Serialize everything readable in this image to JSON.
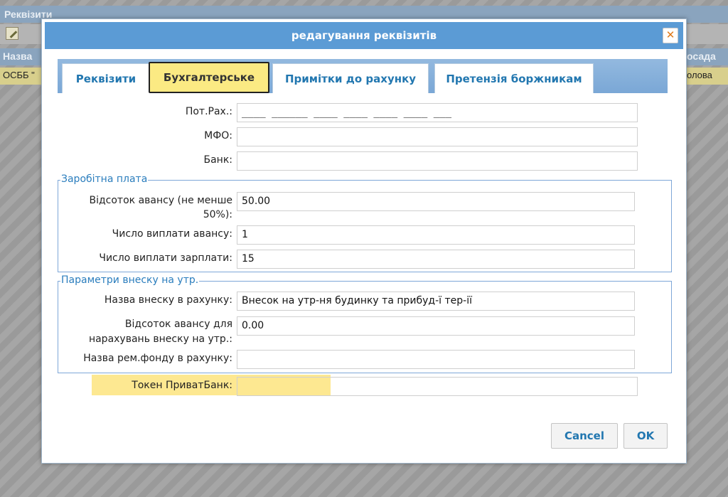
{
  "background": {
    "title": "Реквізити",
    "header_left": "Назва",
    "header_right": "осада",
    "row_left": "ОСББ \"",
    "row_right": "олова"
  },
  "dialog": {
    "title": "редагування реквізитів",
    "close_symbol": "✕",
    "tabs": [
      {
        "label": "Реквізити",
        "active": false
      },
      {
        "label": "Бухгалтерське",
        "active": true
      },
      {
        "label": "Примітки до рахунку",
        "active": false
      },
      {
        "label": "Претензія боржникам",
        "active": false
      }
    ],
    "fields": {
      "account": {
        "label": "Пот.Рах.:",
        "value": "____ ______ ____ ____ ____ ____ ___"
      },
      "mfo": {
        "label": "МФО:",
        "value": ""
      },
      "bank": {
        "label": "Банк:",
        "value": ""
      }
    },
    "salary": {
      "legend": "Заробітна плата",
      "advance_percent": {
        "label_line1": "Відсоток авансу (не менше",
        "label_line2": "50%):",
        "value": "50.00"
      },
      "advance_day": {
        "label": "Число виплати авансу:",
        "value": "1"
      },
      "salary_day": {
        "label": "Число виплати зарплати:",
        "value": "15"
      }
    },
    "contribution": {
      "legend": "Параметри внеску на утр.",
      "name_in_bill": {
        "label": "Назва внеску в рахунку:",
        "value": "Внесок на утр-ня будинку та прибуд-ї тер-ії"
      },
      "advance_percent": {
        "label_line1": "Відсоток авансу для",
        "label_line2": "нарахувань внеску на утр.:",
        "value": "0.00"
      },
      "repair_fund_name": {
        "label": "Назва рем.фонду в рахунку:",
        "value": ""
      }
    },
    "token": {
      "label": "Токен ПриватБанк:",
      "value": ""
    },
    "buttons": {
      "cancel": "Cancel",
      "ok": "OK"
    }
  },
  "colors": {
    "titlebar": "#5b9bd5",
    "active_tab": "#fbea83",
    "tab_text": "#2277b0",
    "legend_text": "#2a7dbd",
    "highlight": "#fde891"
  }
}
